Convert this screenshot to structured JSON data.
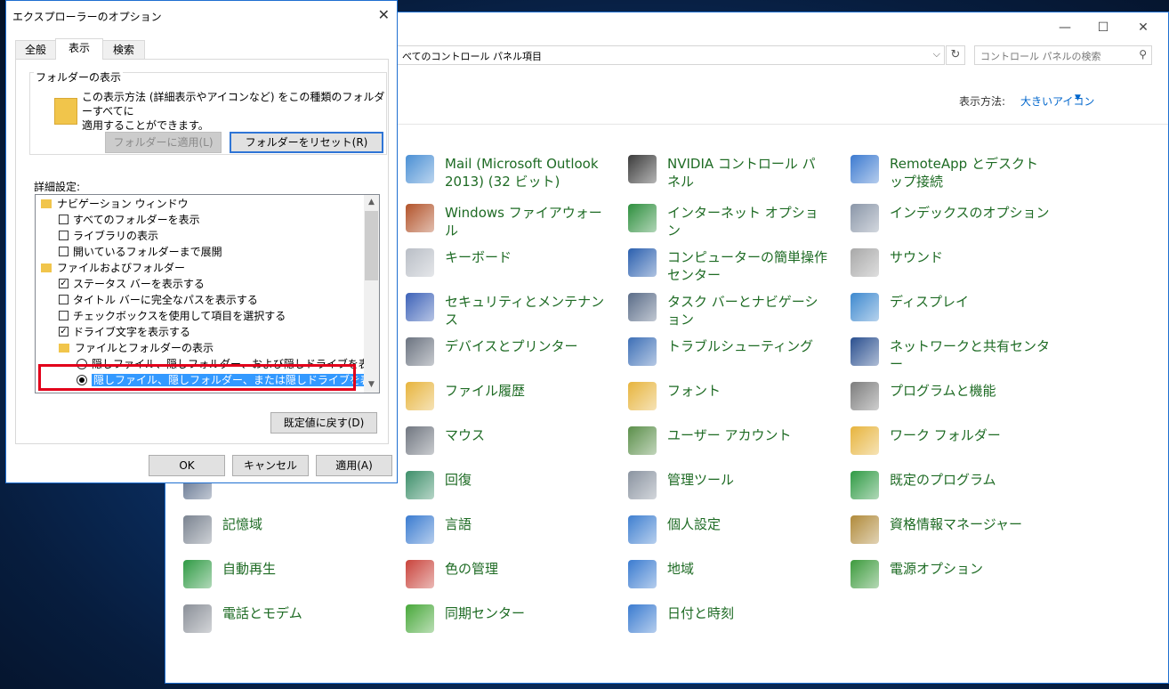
{
  "dialog": {
    "title": "エクスプローラーのオプション",
    "close": "✕",
    "tabs": [
      "全般",
      "表示",
      "検索"
    ],
    "active_tab": "表示",
    "folder_views": {
      "group_title": "フォルダーの表示",
      "description_line1": "この表示方法 (詳細表示やアイコンなど) をこの種類のフォルダーすべてに",
      "description_line2": "適用することができます。",
      "apply_button": "フォルダーに適用(L)",
      "reset_button": "フォルダーをリセット(R)"
    },
    "advanced_label": "詳細設定:",
    "tree": [
      {
        "kind": "folder",
        "indent": 0,
        "label": "ナビゲーション ウィンドウ"
      },
      {
        "kind": "check",
        "indent": 1,
        "checked": false,
        "label": "すべてのフォルダーを表示"
      },
      {
        "kind": "check",
        "indent": 1,
        "checked": false,
        "label": "ライブラリの表示"
      },
      {
        "kind": "check",
        "indent": 1,
        "checked": false,
        "label": "開いているフォルダーまで展開"
      },
      {
        "kind": "folder",
        "indent": 0,
        "label": "ファイルおよびフォルダー"
      },
      {
        "kind": "check",
        "indent": 1,
        "checked": true,
        "label": "ステータス バーを表示する"
      },
      {
        "kind": "check",
        "indent": 1,
        "checked": false,
        "label": "タイトル バーに完全なパスを表示する"
      },
      {
        "kind": "check",
        "indent": 1,
        "checked": false,
        "label": "チェックボックスを使用して項目を選択する"
      },
      {
        "kind": "check",
        "indent": 1,
        "checked": true,
        "label": "ドライブ文字を表示する"
      },
      {
        "kind": "folder",
        "indent": 1,
        "label": "ファイルとフォルダーの表示"
      },
      {
        "kind": "radio",
        "indent": 2,
        "checked": false,
        "label": "隠しファイル、隠しフォルダー、および隠しドライブを表示する"
      },
      {
        "kind": "radio",
        "indent": 2,
        "checked": true,
        "selected": true,
        "label": "隠しファイル、隠しフォルダー、または隠しドライブを表示しない"
      }
    ],
    "restore_defaults": "既定値に戻す(D)",
    "ok": "OK",
    "cancel": "キャンセル",
    "apply": "適用(A)"
  },
  "control_panel": {
    "address": "べてのコントロール パネル項目",
    "search_placeholder": "コントロール パネルの検索",
    "view_by_label": "表示方法:",
    "view_by_value": "大きいアイコン",
    "items": [
      {
        "label": "Mail (Microsoft Outlook 2013) (32 ビット)",
        "icon": "mail-icon",
        "color": "#4a8fd4"
      },
      {
        "label": "NVIDIA コントロール パネル",
        "icon": "nvidia-icon",
        "color": "#3b3b3b"
      },
      {
        "label": "RemoteApp とデスクトップ接続",
        "icon": "remoteapp-icon",
        "color": "#3c7ad0"
      },
      {
        "label": "Windows ファイアウォール",
        "icon": "firewall-icon",
        "color": "#b2532a"
      },
      {
        "label": "インターネット オプション",
        "icon": "internet-options-icon",
        "color": "#2e8f3e"
      },
      {
        "label": "インデックスのオプション",
        "icon": "indexing-icon",
        "color": "#8a96a8"
      },
      {
        "label": "キーボード",
        "icon": "keyboard-icon",
        "color": "#b9bec6"
      },
      {
        "label": "コンピューターの簡単操作センター",
        "icon": "ease-of-access-icon",
        "color": "#2a5fae"
      },
      {
        "label": "サウンド",
        "icon": "sound-icon",
        "color": "#a8a8a8"
      },
      {
        "label": "セキュリティとメンテナンス",
        "icon": "security-flag-icon",
        "color": "#3d62b8"
      },
      {
        "label": "タスク バーとナビゲーション",
        "icon": "taskbar-icon",
        "color": "#5a6c88"
      },
      {
        "label": "ディスプレイ",
        "icon": "display-icon",
        "color": "#3e89cf"
      },
      {
        "label": "デバイスとプリンター",
        "icon": "devices-printers-icon",
        "color": "#6b7380"
      },
      {
        "label": "トラブルシューティング",
        "icon": "troubleshooting-icon",
        "color": "#3d6fb6"
      },
      {
        "label": "ネットワークと共有センター",
        "icon": "network-icon",
        "color": "#2a4f8f"
      },
      {
        "label": "ファイル履歴",
        "icon": "file-history-icon",
        "color": "#e7b43d"
      },
      {
        "label": "フォント",
        "icon": "fonts-icon",
        "color": "#e7b43d"
      },
      {
        "label": "プログラムと機能",
        "icon": "programs-icon",
        "color": "#7d7d7d"
      },
      {
        "label": "マウス",
        "icon": "mouse-icon",
        "color": "#707680"
      },
      {
        "label": "ユーザー アカウント",
        "icon": "user-accounts-icon",
        "color": "#5b8f4a"
      },
      {
        "label": "ワーク フォルダー",
        "icon": "work-folders-icon",
        "color": "#e7b43d"
      },
      {
        "label": "",
        "icon": "autoplay-icon",
        "color": "#5b6d8a"
      },
      {
        "label": "回復",
        "icon": "recovery-icon",
        "color": "#3d8f6a"
      },
      {
        "label": "管理ツール",
        "icon": "admin-tools-icon",
        "color": "#8a93a0"
      },
      {
        "label": "既定のプログラム",
        "icon": "default-programs-icon",
        "color": "#2f9a44"
      },
      {
        "label": "記憶域",
        "icon": "storage-spaces-icon",
        "color": "#7a8390"
      },
      {
        "label": "言語",
        "icon": "language-icon",
        "color": "#3a7bd0"
      },
      {
        "label": "個人設定",
        "icon": "personalization-icon",
        "color": "#3f7fd0"
      },
      {
        "label": "資格情報マネージャー",
        "icon": "credential-manager-icon",
        "color": "#b08a3a"
      },
      {
        "label": "自動再生",
        "icon": "autoplay-icon",
        "color": "#2f9a44"
      },
      {
        "label": "色の管理",
        "icon": "color-management-icon",
        "color": "#c9433b"
      },
      {
        "label": "地域",
        "icon": "region-icon",
        "color": "#3a7bd0"
      },
      {
        "label": "電源オプション",
        "icon": "power-options-icon",
        "color": "#3c9a3c"
      },
      {
        "label": "電話とモデム",
        "icon": "phone-modem-icon",
        "color": "#8a8f98"
      },
      {
        "label": "同期センター",
        "icon": "sync-center-icon",
        "color": "#48a83a"
      },
      {
        "label": "日付と時刻",
        "icon": "date-time-icon",
        "color": "#3a7bd0"
      }
    ]
  }
}
